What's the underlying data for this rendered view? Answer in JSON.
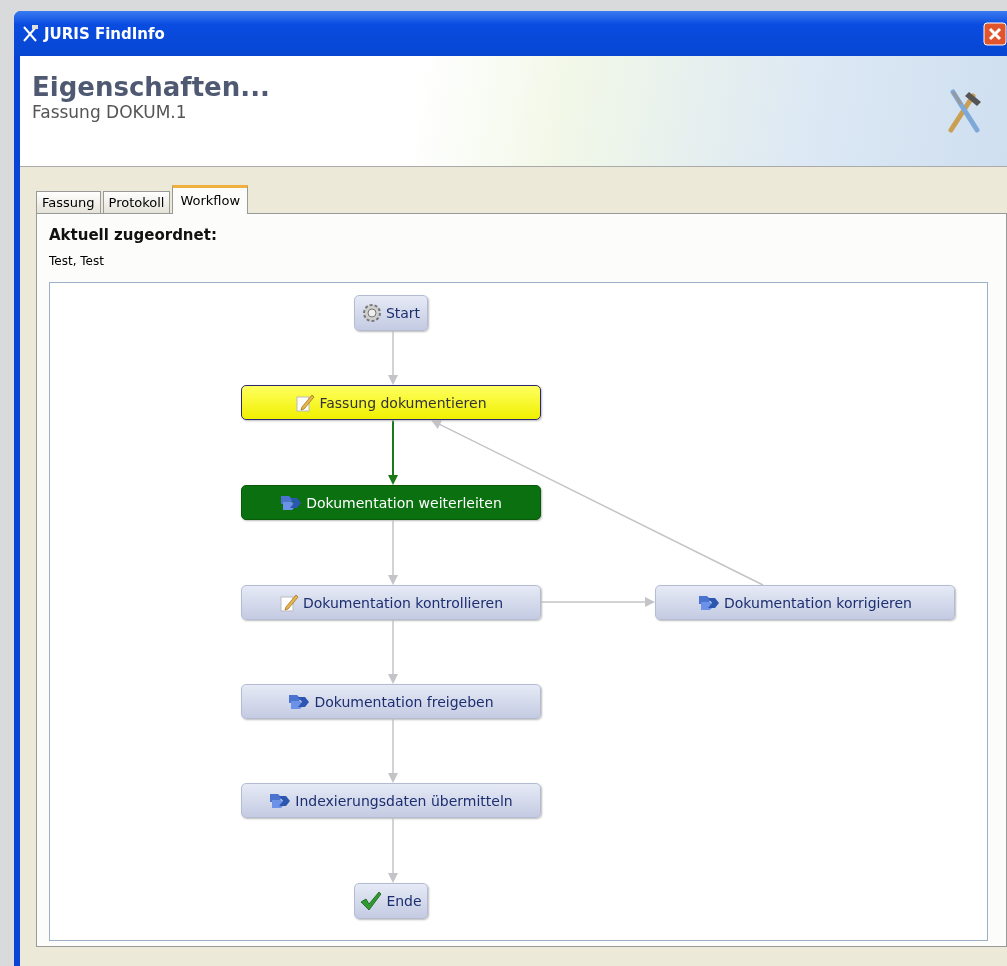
{
  "window": {
    "title": "JURIS FindInfo"
  },
  "header": {
    "title": "Eigenschaften...",
    "subtitle": "Fassung DOKUM.1"
  },
  "tabs": [
    {
      "label": "Fassung",
      "selected": false
    },
    {
      "label": "Protokoll",
      "selected": false
    },
    {
      "label": "Workflow",
      "selected": true
    }
  ],
  "assignment": {
    "heading": "Aktuell zugeordnet:",
    "value": "Test, Test"
  },
  "workflow": {
    "nodes": [
      {
        "label": "Start",
        "kind": "gear",
        "selected": false,
        "active": false
      },
      {
        "label": "Fassung dokumentieren",
        "kind": "edit",
        "selected": true,
        "active": false
      },
      {
        "label": "Dokumentation weiterleiten",
        "kind": "forward",
        "selected": false,
        "active": true
      },
      {
        "label": "Dokumentation kontrollieren",
        "kind": "edit",
        "selected": false,
        "active": false
      },
      {
        "label": "Dokumentation korrigieren",
        "kind": "forward",
        "selected": false,
        "active": false
      },
      {
        "label": "Dokumentation freigeben",
        "kind": "forward",
        "selected": false,
        "active": false
      },
      {
        "label": "Indexierungsdaten übermitteln",
        "kind": "forward",
        "selected": false,
        "active": false
      },
      {
        "label": "Ende",
        "kind": "check",
        "selected": false,
        "active": false
      }
    ]
  }
}
